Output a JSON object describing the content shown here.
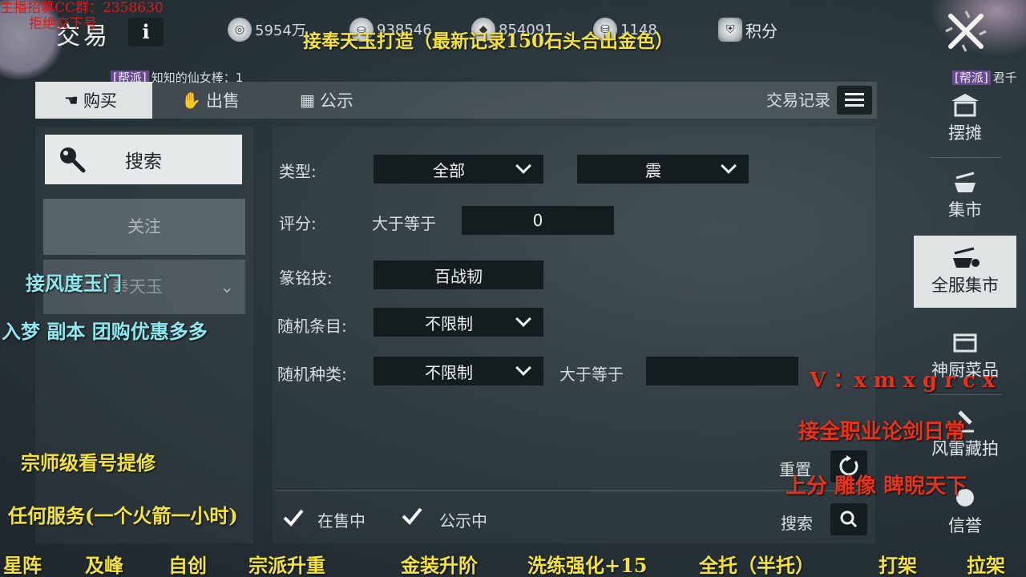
{
  "overlay": {
    "top_left_line1": "主播招募CC群：2358630",
    "top_left_line2": "拒绝交下号",
    "banner": "接奉天玉打造（最新记录150石头合出金色）",
    "left_cyan_1": "接风度玉门",
    "left_cyan_2": "入梦  副本 团购优惠多多",
    "left_yellow_1": "宗师级看号提修",
    "left_yellow_2": "任何服务(一个火箭一小时)",
    "right_red_1": "V ：x m x g r c x",
    "right_red_2": "接全职业论剑日常",
    "right_red_3": "上分   雕像  睥睨天下",
    "bottom_items": [
      "星阵",
      "及峰",
      "自创",
      "宗派升重",
      "金装升阶",
      "洗练强化+15",
      "全托（半托）",
      "打架",
      "拉架"
    ]
  },
  "header": {
    "title": "交易",
    "info_label": "i",
    "currencies": [
      {
        "icon": "coin-icon",
        "value": "5954万"
      },
      {
        "icon": "silver-ingot-icon",
        "value": "938546"
      },
      {
        "icon": "jade-icon",
        "value": "854091"
      },
      {
        "icon": "gold-ingot-icon",
        "value": "1148"
      },
      {
        "icon": "shield-points-icon",
        "value": "积分"
      }
    ]
  },
  "guild_left": {
    "tag": "[帮派]",
    "text": "知知的仙女棒：1"
  },
  "guild_right": {
    "tag": "[帮派]",
    "text": "君千"
  },
  "tabs": [
    {
      "label": "购买",
      "icon": "buy-icon"
    },
    {
      "label": "出售",
      "icon": "sell-icon"
    },
    {
      "label": "公示",
      "icon": "notice-icon"
    }
  ],
  "trade_record": "交易记录",
  "left": {
    "search_label": "搜索",
    "follow_label": "关注",
    "item_select": "奉天玉"
  },
  "filters": {
    "type_label": "类型:",
    "type_value": "全部",
    "type_sub_value": "震",
    "score_label": "评分:",
    "score_op": "大于等于",
    "score_value": "0",
    "inscription_label": "篆铭技:",
    "inscription_value": "百战韧",
    "random_entries_label": "随机条目:",
    "random_entries_value": "不限制",
    "random_type_label": "随机种类:",
    "random_type_value": "不限制",
    "random_type_op": "大于等于",
    "random_type_input": "",
    "reset_label": "重置",
    "search_label": "搜索",
    "on_sale_label": "在售中",
    "on_notice_label": "公示中"
  },
  "rightnav": [
    {
      "label": "摆摊",
      "icon": "stall-icon",
      "active": false
    },
    {
      "label": "集市",
      "icon": "market-icon",
      "active": false
    },
    {
      "label": "全服集市",
      "icon": "server-market-icon",
      "active": true
    },
    {
      "label": "神厨菜品",
      "icon": "chef-dish-icon",
      "active": false
    },
    {
      "label": "风雷藏拍",
      "icon": "auction-icon",
      "active": false
    },
    {
      "label": "信誉",
      "icon": "reputation-icon",
      "active": false
    }
  ]
}
